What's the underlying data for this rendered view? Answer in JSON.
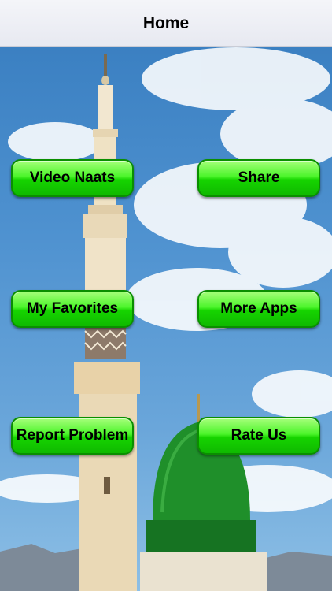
{
  "header": {
    "title": "Home"
  },
  "menu": {
    "video_naats": "Video Naats",
    "share": "Share",
    "my_favorites": "My Favorites",
    "more_apps": "More Apps",
    "report_problem": "Report Problem",
    "rate_us": "Rate Us"
  },
  "background": {
    "image": "mosque-minaret-green-dome-photo"
  },
  "colors": {
    "button_green": "#16d400",
    "sky_blue": "#4f92d0",
    "dome_green": "#1f8f2a"
  }
}
